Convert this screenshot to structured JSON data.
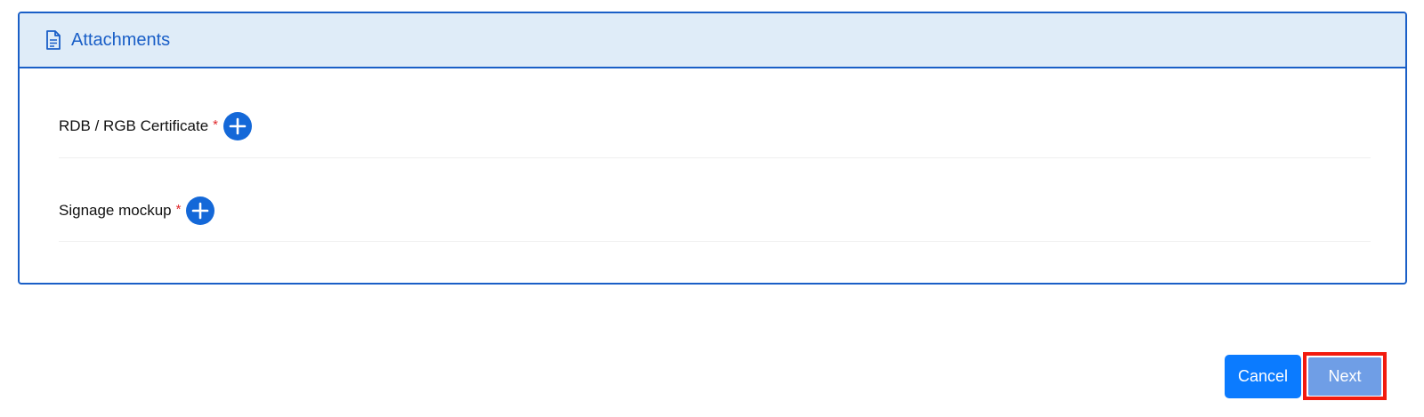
{
  "panel": {
    "title": "Attachments",
    "icon": "document-icon"
  },
  "fields": [
    {
      "label": "RDB / RGB Certificate",
      "required_mark": "*",
      "add_icon": "plus-circle-icon"
    },
    {
      "label": "Signage mockup",
      "required_mark": "*",
      "add_icon": "plus-circle-icon"
    }
  ],
  "actions": {
    "cancel_label": "Cancel",
    "next_label": "Next"
  },
  "colors": {
    "accent": "#1a5fc7",
    "header_bg": "#dfecf8",
    "required": "#e0272b",
    "cancel_bg": "#0b7bff",
    "next_bg": "#6f9ee6",
    "highlight": "#f21b0f"
  }
}
